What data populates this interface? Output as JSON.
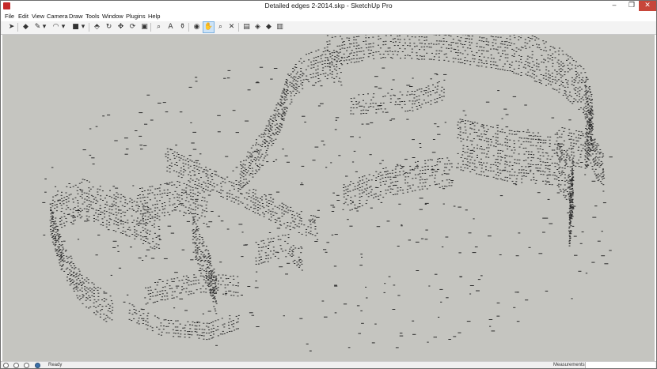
{
  "window": {
    "title": "Detailed edges 2-2014.skp - SketchUp Pro",
    "controls": {
      "minimize": "‒",
      "maximize": "❐",
      "close": "✕"
    }
  },
  "menu": {
    "items": [
      "File",
      "Edit",
      "View",
      "Camera",
      "Draw",
      "Tools",
      "Window",
      "Plugins",
      "Help"
    ]
  },
  "toolbar": {
    "tools": [
      {
        "name": "select-icon",
        "glyph": "➤"
      },
      {
        "name": "eraser-icon",
        "glyph": "◆"
      },
      {
        "name": "pencil-icon",
        "glyph": "✎"
      },
      {
        "name": "dropdown-icon",
        "glyph": "▾"
      },
      {
        "name": "arc-icon",
        "glyph": "◠"
      },
      {
        "name": "dropdown-icon",
        "glyph": "▾"
      },
      {
        "name": "shapes-icon",
        "glyph": "■"
      },
      {
        "name": "dropdown-icon",
        "glyph": "▾"
      },
      {
        "name": "push-pull-icon",
        "glyph": "⬘"
      },
      {
        "name": "follow-me-icon",
        "glyph": "↻"
      },
      {
        "name": "move-icon",
        "glyph": "✥"
      },
      {
        "name": "rotate-icon",
        "glyph": "⟳"
      },
      {
        "name": "scale-icon",
        "glyph": "▣"
      },
      {
        "name": "tape-measure-icon",
        "glyph": "⌕"
      },
      {
        "name": "text-icon",
        "glyph": "A"
      },
      {
        "name": "paint-bucket-icon",
        "glyph": "⚱"
      },
      {
        "name": "orbit-icon",
        "glyph": "◉"
      },
      {
        "name": "pan-icon",
        "glyph": "✋"
      },
      {
        "name": "zoom-icon",
        "glyph": "⌕"
      },
      {
        "name": "zoom-extents-icon",
        "glyph": "✕"
      },
      {
        "name": "warehouse-icon",
        "glyph": "▤"
      },
      {
        "name": "components-icon",
        "glyph": "◈"
      },
      {
        "name": "extension-warehouse-icon",
        "glyph": "◆"
      },
      {
        "name": "layout-icon",
        "glyph": "▥"
      }
    ],
    "active_index": 17
  },
  "status": {
    "text": "Ready",
    "measurements_label": "Measurements",
    "icons": [
      "geo-location-icon",
      "credits-icon",
      "user-icon",
      "help-icon"
    ]
  },
  "colors": {
    "viewport": "#c5c5c0",
    "edge": "#2b2b2b",
    "close_button": "#c7463a",
    "active_tool": "#cde3f7"
  }
}
